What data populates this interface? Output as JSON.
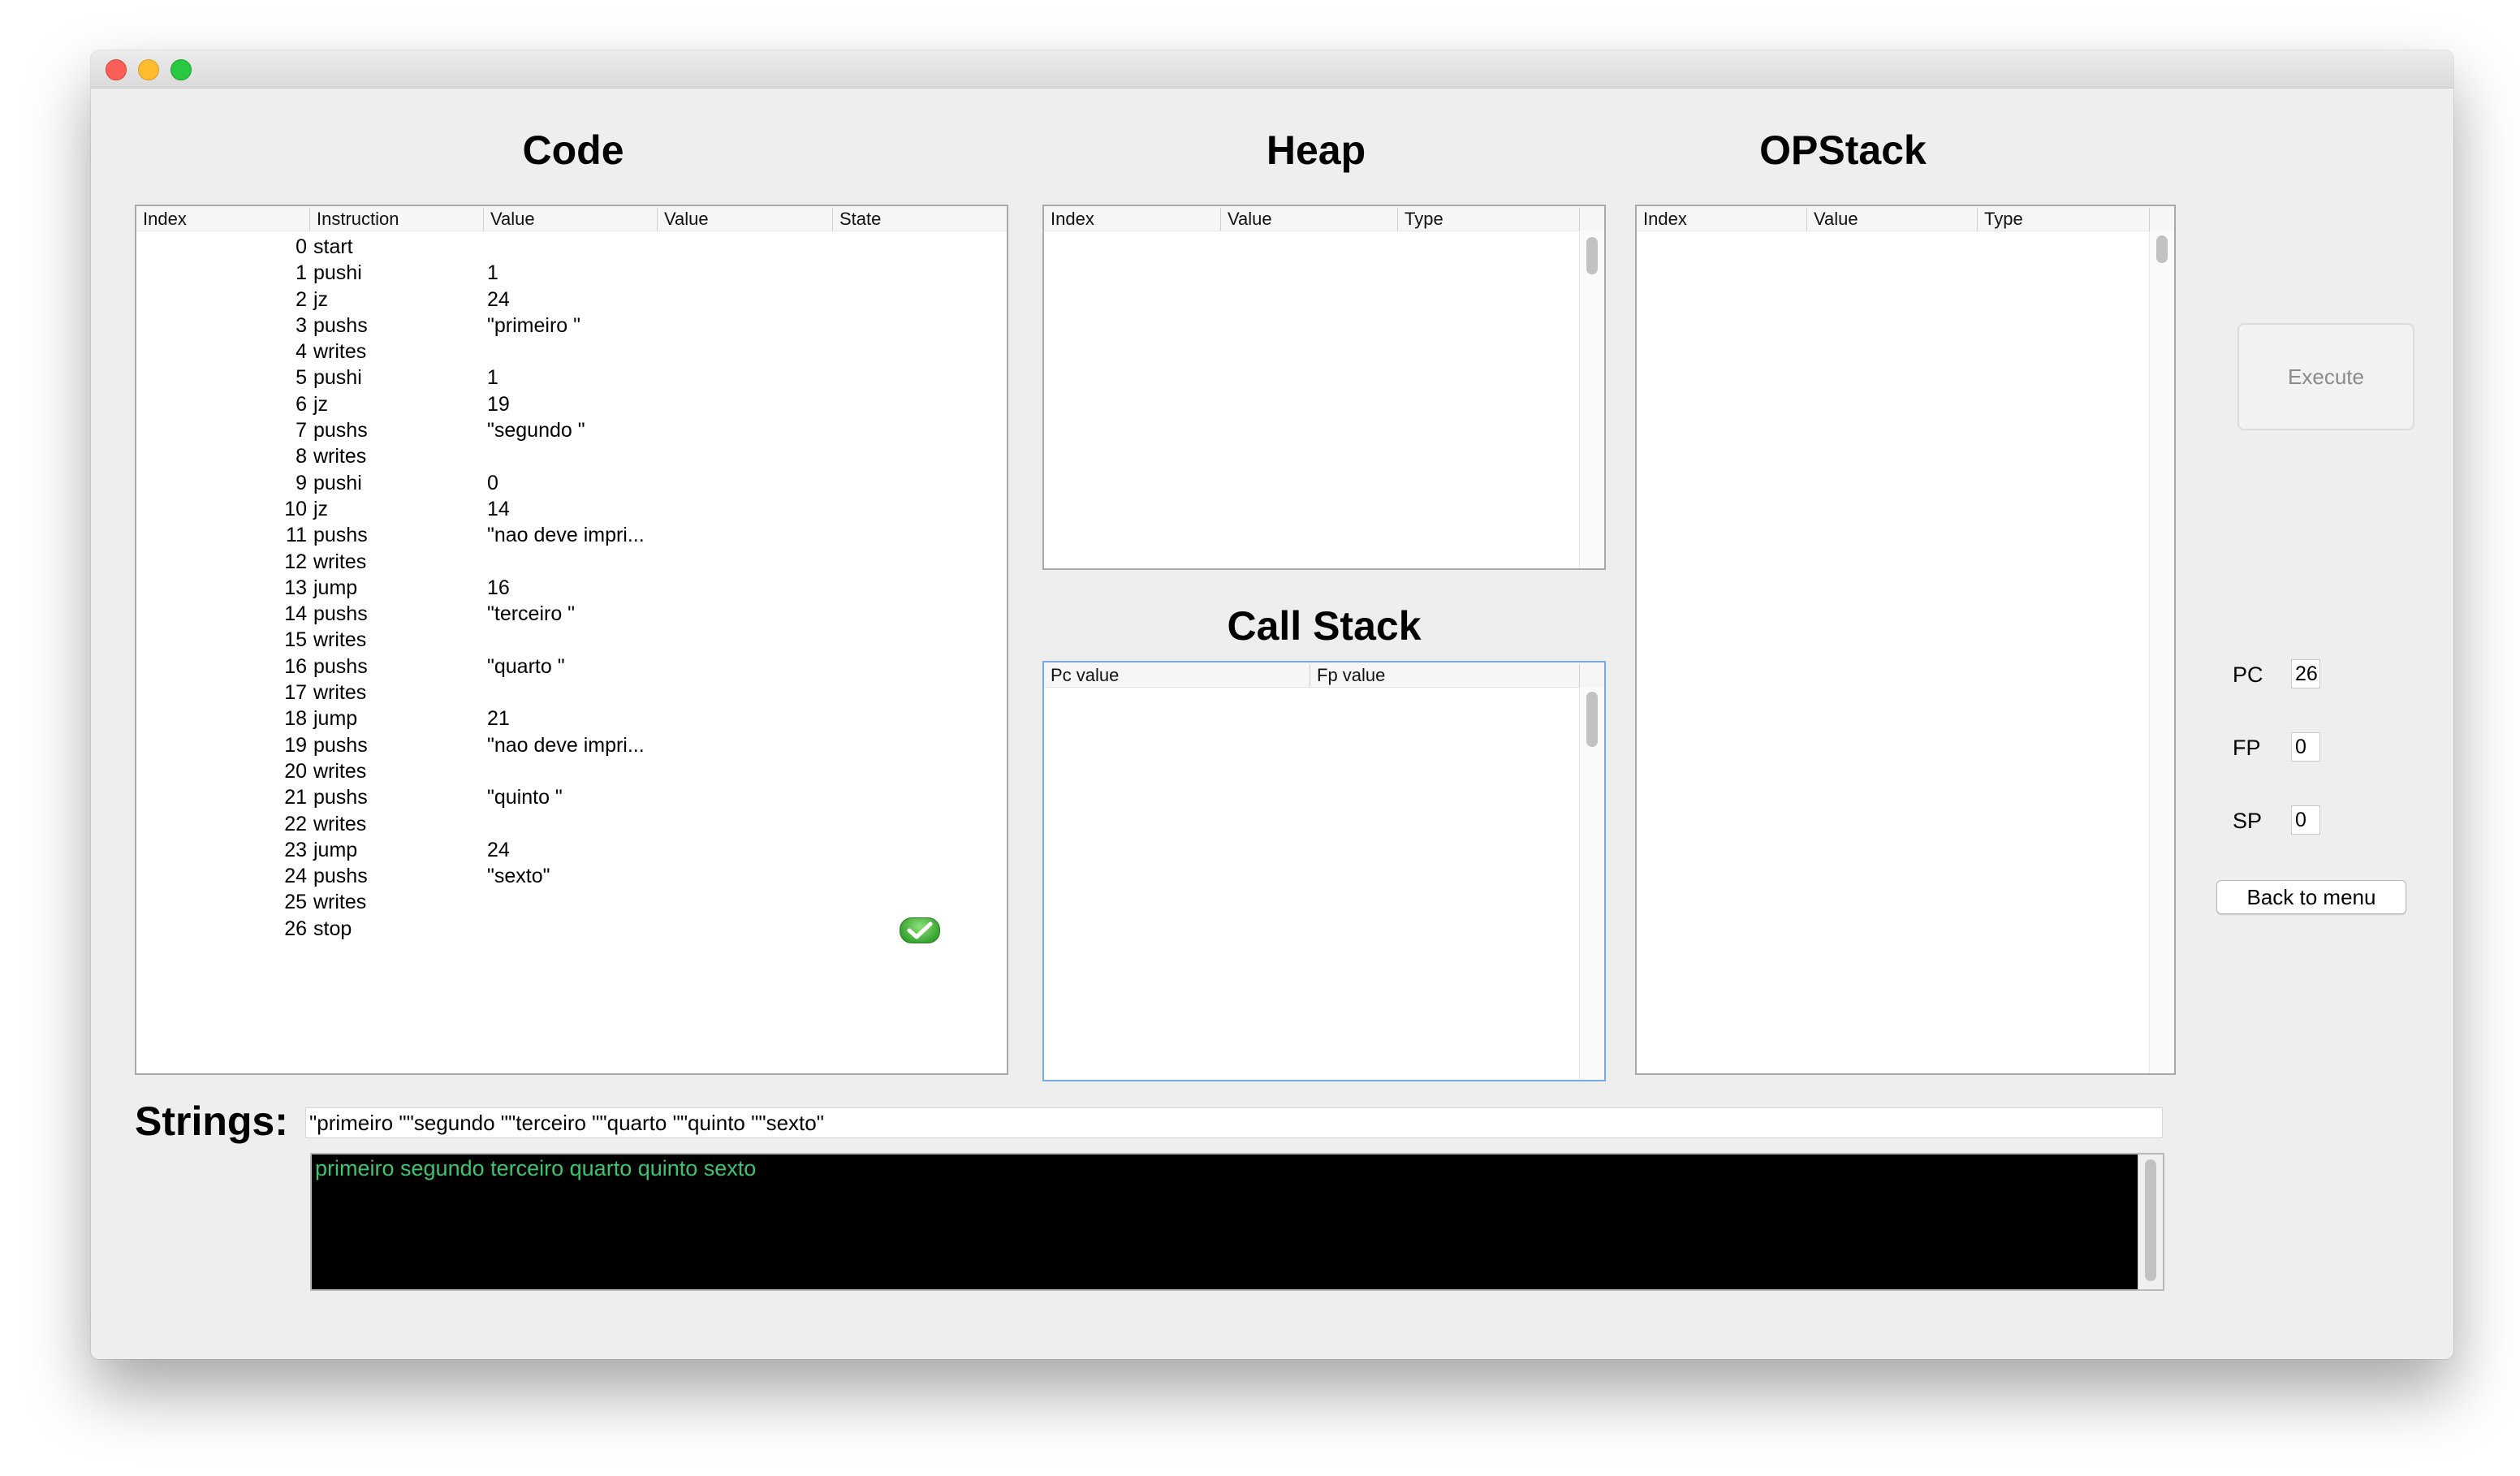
{
  "sections": {
    "code": "Code",
    "heap": "Heap",
    "opstack": "OPStack",
    "callstack": "Call Stack"
  },
  "code_table": {
    "headers": [
      "Index",
      "Instruction",
      "Value",
      "Value",
      "State"
    ],
    "rows": [
      {
        "index": "0",
        "instruction": "start",
        "value": ""
      },
      {
        "index": "1",
        "instruction": "pushi",
        "value": "1"
      },
      {
        "index": "2",
        "instruction": "jz",
        "value": "24"
      },
      {
        "index": "3",
        "instruction": "pushs",
        "value": "\"primeiro \""
      },
      {
        "index": "4",
        "instruction": "writes",
        "value": ""
      },
      {
        "index": "5",
        "instruction": "pushi",
        "value": "1"
      },
      {
        "index": "6",
        "instruction": "jz",
        "value": "19"
      },
      {
        "index": "7",
        "instruction": "pushs",
        "value": "\"segundo \""
      },
      {
        "index": "8",
        "instruction": "writes",
        "value": ""
      },
      {
        "index": "9",
        "instruction": "pushi",
        "value": "0"
      },
      {
        "index": "10",
        "instruction": "jz",
        "value": "14"
      },
      {
        "index": "11",
        "instruction": "pushs",
        "value": "\"nao deve impri..."
      },
      {
        "index": "12",
        "instruction": "writes",
        "value": ""
      },
      {
        "index": "13",
        "instruction": "jump",
        "value": "16"
      },
      {
        "index": "14",
        "instruction": "pushs",
        "value": "\"terceiro \""
      },
      {
        "index": "15",
        "instruction": "writes",
        "value": ""
      },
      {
        "index": "16",
        "instruction": "pushs",
        "value": "\"quarto \""
      },
      {
        "index": "17",
        "instruction": "writes",
        "value": ""
      },
      {
        "index": "18",
        "instruction": "jump",
        "value": "21"
      },
      {
        "index": "19",
        "instruction": "pushs",
        "value": "\"nao deve impri..."
      },
      {
        "index": "20",
        "instruction": "writes",
        "value": ""
      },
      {
        "index": "21",
        "instruction": "pushs",
        "value": "\"quinto \""
      },
      {
        "index": "22",
        "instruction": "writes",
        "value": ""
      },
      {
        "index": "23",
        "instruction": "jump",
        "value": "24"
      },
      {
        "index": "24",
        "instruction": "pushs",
        "value": "\"sexto\""
      },
      {
        "index": "25",
        "instruction": "writes",
        "value": ""
      },
      {
        "index": "26",
        "instruction": "stop",
        "value": "",
        "state": "check-icon"
      }
    ]
  },
  "heap_table": {
    "headers": [
      "Index",
      "Value",
      "Type"
    ]
  },
  "opstack_table": {
    "headers": [
      "Index",
      "Value",
      "Type"
    ]
  },
  "callstack_table": {
    "headers": [
      "Pc value",
      "Fp value"
    ]
  },
  "controls": {
    "execute_label": "Execute",
    "back_label": "Back to menu",
    "pc_label": "PC",
    "pc_value": "26",
    "fp_label": "FP",
    "fp_value": "0",
    "sp_label": "SP",
    "sp_value": "0"
  },
  "strings": {
    "label": "Strings:",
    "value": "\"primeiro \"\"segundo \"\"terceiro \"\"quarto \"\"quinto \"\"sexto\"",
    "output": "primeiro segundo terceiro quarto quinto sexto"
  },
  "colors": {
    "console_bg": "#000000",
    "console_text": "#3ec46d",
    "focus_border": "#7aa9e0"
  }
}
